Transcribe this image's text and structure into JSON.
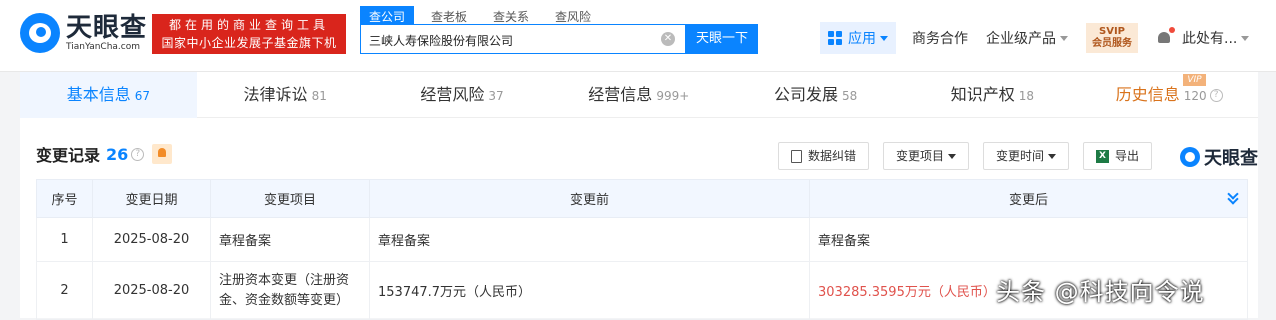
{
  "header": {
    "logo_cn": "天眼查",
    "logo_en": "TianYanCha.com",
    "slogan_line1": "都在用的商业查询工具",
    "slogan_line2": "国家中小企业发展子基金旗下机构",
    "search_tabs": [
      "查公司",
      "查老板",
      "查关系",
      "查风险"
    ],
    "search_value": "三峡人寿保险股份有限公司",
    "search_button": "天眼一下",
    "app_label": "应用",
    "nav": [
      "商务合作",
      "企业级产品"
    ],
    "svip_line1": "SVIP",
    "svip_line2": "会员服务",
    "user_label": "此处有..."
  },
  "tabs": [
    {
      "label": "基本信息",
      "count": "67"
    },
    {
      "label": "法律诉讼",
      "count": "81"
    },
    {
      "label": "经营风险",
      "count": "37"
    },
    {
      "label": "经营信息",
      "count": "999+"
    },
    {
      "label": "公司发展",
      "count": "58"
    },
    {
      "label": "知识产权",
      "count": "18"
    },
    {
      "label": "历史信息",
      "count": "120",
      "badge": "VIP"
    }
  ],
  "section": {
    "title": "变更记录",
    "count": "26",
    "buttons": {
      "correction": "数据纠错",
      "change_item": "变更项目",
      "change_time": "变更时间",
      "export": "导出"
    },
    "brand": "天眼查"
  },
  "table": {
    "headers": [
      "序号",
      "变更日期",
      "变更项目",
      "变更前",
      "变更后"
    ],
    "rows": [
      {
        "idx": "1",
        "date": "2025-08-20",
        "item": "章程备案",
        "before": "章程备案",
        "after": "章程备案"
      },
      {
        "idx": "2",
        "date": "2025-08-20",
        "item": "注册资本变更（注册资金、资金数额等变更）",
        "before": "153747.7万元（人民币）",
        "after": "303285.3595万元（人民币）"
      }
    ]
  },
  "watermark": "头条 @科技向令说",
  "colors": {
    "brand_blue": "#0a84ff",
    "slogan_red": "#d9251c",
    "change_red": "#e0524c",
    "history_orange": "#d9731c"
  }
}
